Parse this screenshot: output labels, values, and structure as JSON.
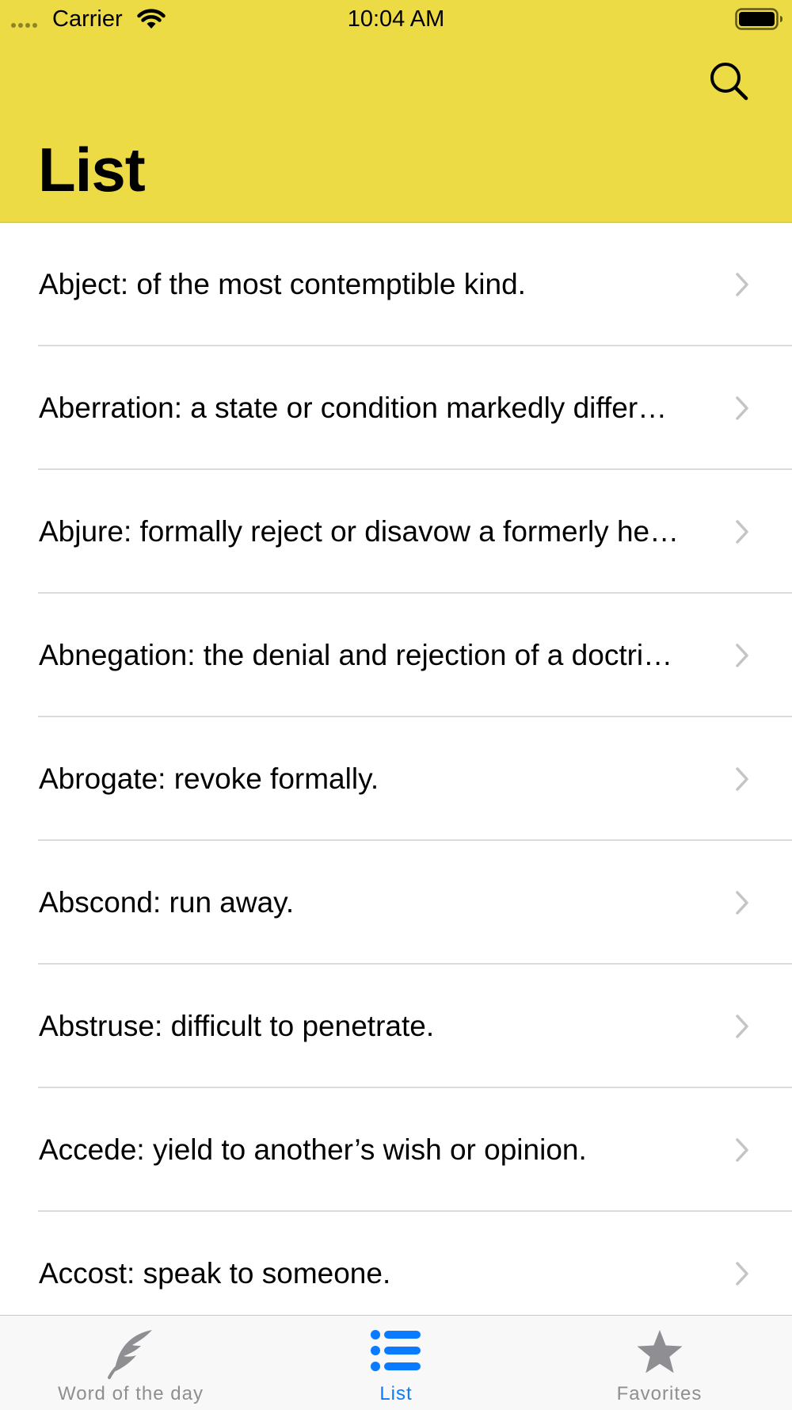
{
  "status_bar": {
    "carrier": "Carrier",
    "time": "10:04 AM"
  },
  "header": {
    "title": "List",
    "search_icon": "search-icon",
    "background_color": "#ecdb45"
  },
  "list": {
    "items": [
      {
        "label": "Abject: of the most contemptible kind."
      },
      {
        "label": "Aberration: a state or condition markedly differ…"
      },
      {
        "label": "Abjure: formally reject or disavow a formerly he…"
      },
      {
        "label": "Abnegation: the denial and rejection of a doctri…"
      },
      {
        "label": "Abrogate: revoke formally."
      },
      {
        "label": "Abscond: run away."
      },
      {
        "label": "Abstruse: difficult to penetrate."
      },
      {
        "label": "Accede: yield to another’s wish or opinion."
      },
      {
        "label": "Accost: speak to someone."
      }
    ]
  },
  "tab_bar": {
    "tabs": [
      {
        "label": "Word of the day",
        "icon": "feather-icon",
        "selected": false
      },
      {
        "label": "List",
        "icon": "list-icon",
        "selected": true
      },
      {
        "label": "Favorites",
        "icon": "star-icon",
        "selected": false
      }
    ],
    "active_color": "#0a7aff",
    "inactive_color": "#8e8e93"
  }
}
